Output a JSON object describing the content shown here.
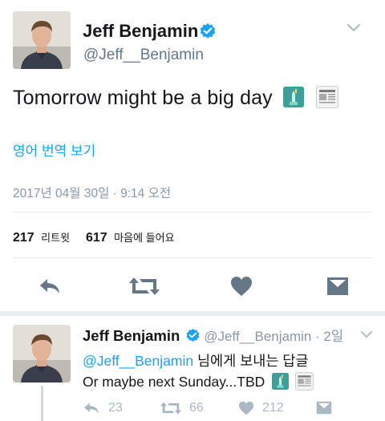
{
  "main_tweet": {
    "author_name": "Jeff Benjamin",
    "handle": "@Jeff__Benjamin",
    "text": "Tomorrow might be a big day",
    "emoji": [
      "statue-of-liberty-icon",
      "newspaper-icon"
    ],
    "translate_label": "영어 번역 보기",
    "timestamp": "2017년 04월 30일 · 9:14 오전",
    "retweets": {
      "count": "217",
      "label": "리트윗"
    },
    "likes": {
      "count": "617",
      "label": "마음에 들어요"
    },
    "actions": [
      "reply-icon",
      "retweet-icon",
      "heart-icon",
      "direct-message-icon"
    ]
  },
  "reply_tweet": {
    "author_name": "Jeff Benjamin",
    "handle": "@Jeff__Benjamin",
    "time_ago": "· 2일",
    "reply_to_handle": "@Jeff__Benjamin",
    "reply_to_suffix": "님에게 보내는 답글",
    "text": "Or maybe next Sunday...TBD",
    "reply_count": "23",
    "retweet_count": "66",
    "like_count": "212"
  },
  "colors": {
    "accent": "#1da1f2",
    "text": "#14171a",
    "muted": "#657786",
    "icon": "#657786",
    "divider": "#e6ecf0"
  }
}
